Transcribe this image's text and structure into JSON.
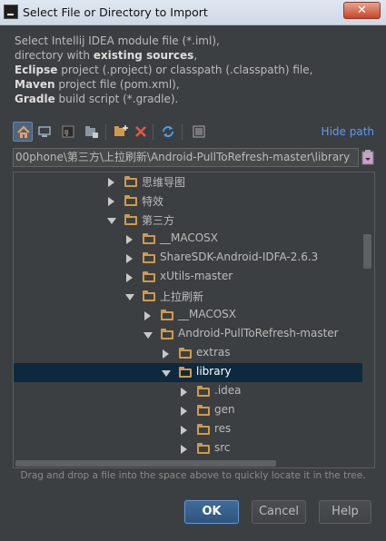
{
  "window": {
    "title": "Select File or Directory to Import",
    "close_symbol": "✕"
  },
  "description": {
    "lines": [
      [
        {
          "t": "Select Intellij IDEA module file (*.iml),",
          "b": false
        }
      ],
      [
        {
          "t": "directory with ",
          "b": false
        },
        {
          "t": "existing sources",
          "b": true
        },
        {
          "t": ",",
          "b": false
        }
      ],
      [
        {
          "t": "Eclipse",
          "b": true
        },
        {
          "t": " project (.project) or classpath (.classpath) file,",
          "b": false
        }
      ],
      [
        {
          "t": "Maven",
          "b": true
        },
        {
          "t": " project file (pom.xml),",
          "b": false
        }
      ],
      [
        {
          "t": "Gradle",
          "b": true
        },
        {
          "t": " build script (*.gradle).",
          "b": false
        }
      ]
    ]
  },
  "toolbar": {
    "buttons": [
      {
        "name": "home-icon",
        "active": true
      },
      {
        "name": "desktop-icon",
        "active": false
      },
      {
        "name": "project-icon",
        "active": false
      },
      {
        "name": "module-folder-icon",
        "active": false
      },
      {
        "name": "new-folder-icon",
        "active": false
      },
      {
        "name": "delete-icon",
        "active": false
      },
      {
        "name": "refresh-icon",
        "active": false
      },
      {
        "name": "show-hidden-icon",
        "active": false
      }
    ],
    "hide_path_label": "Hide path"
  },
  "path": {
    "value": "00phone\\第三方\\上拉刷新\\Android-PullToRefresh-master\\library"
  },
  "tree": {
    "rows": [
      {
        "label": "思维导图",
        "depth": 0,
        "expanded": false,
        "selected": false
      },
      {
        "label": "特效",
        "depth": 0,
        "expanded": false,
        "selected": false
      },
      {
        "label": "第三方",
        "depth": 0,
        "expanded": true,
        "selected": false
      },
      {
        "label": "__MACOSX",
        "depth": 1,
        "expanded": false,
        "selected": false
      },
      {
        "label": "ShareSDK-Android-IDFA-2.6.3",
        "depth": 1,
        "expanded": false,
        "selected": false
      },
      {
        "label": "xUtils-master",
        "depth": 1,
        "expanded": false,
        "selected": false
      },
      {
        "label": "上拉刷新",
        "depth": 1,
        "expanded": true,
        "selected": false
      },
      {
        "label": "__MACOSX",
        "depth": 2,
        "expanded": false,
        "selected": false
      },
      {
        "label": "Android-PullToRefresh-master",
        "depth": 2,
        "expanded": true,
        "selected": false
      },
      {
        "label": "extras",
        "depth": 3,
        "expanded": false,
        "selected": false
      },
      {
        "label": "library",
        "depth": 3,
        "expanded": true,
        "selected": true
      },
      {
        "label": ".idea",
        "depth": 4,
        "expanded": false,
        "selected": false
      },
      {
        "label": "gen",
        "depth": 4,
        "expanded": false,
        "selected": false
      },
      {
        "label": "res",
        "depth": 4,
        "expanded": false,
        "selected": false
      },
      {
        "label": "src",
        "depth": 4,
        "expanded": false,
        "selected": false
      }
    ]
  },
  "hint": "Drag and drop a file into the space above to quickly locate it in the tree.",
  "buttons": {
    "ok": "OK",
    "cancel": "Cancel",
    "help": "Help"
  },
  "colors": {
    "background": "#3c3f41",
    "selection": "#0d293e",
    "link": "#589df6",
    "folder": "#d19a4a"
  }
}
